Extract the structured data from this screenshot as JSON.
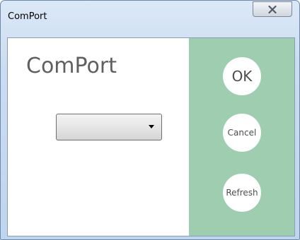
{
  "window": {
    "title": "ComPort",
    "close_icon": "close-x-icon"
  },
  "main": {
    "heading": "ComPort",
    "combo": {
      "value": "",
      "icon": "dropdown-arrow-icon"
    }
  },
  "actions": {
    "ok_label": "OK",
    "cancel_label": "Cancel",
    "refresh_label": "Refresh"
  },
  "colors": {
    "accent_panel": "#9ecdb0",
    "button_fill": "#ffffff",
    "heading_text": "#5f5f5f"
  }
}
